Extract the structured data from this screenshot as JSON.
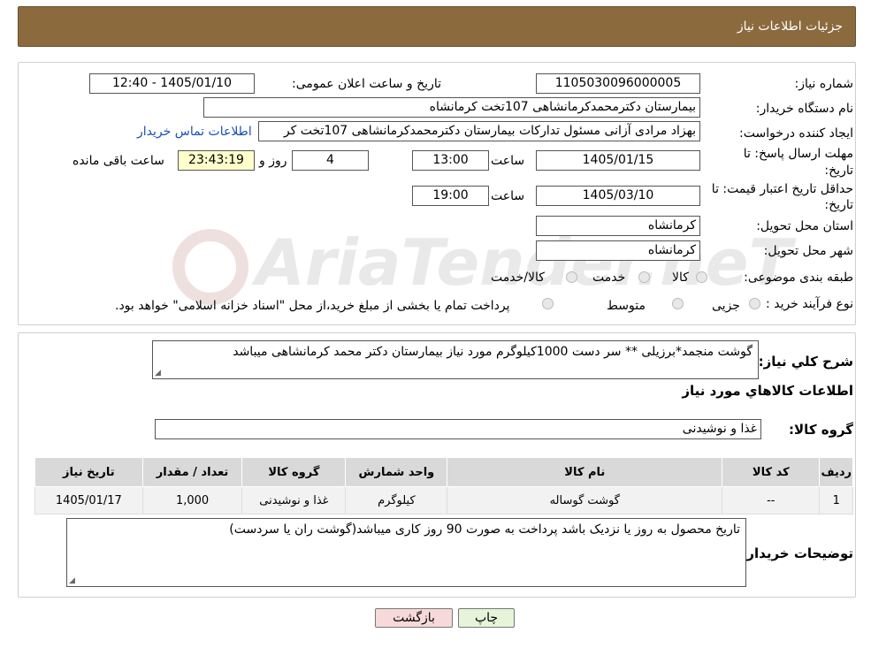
{
  "header": {
    "title": "جزئیات اطلاعات نیاز"
  },
  "watermark": {
    "text": "AriaTender.neT"
  },
  "form": {
    "need_number_label": "شماره نیاز:",
    "need_number": "1105030096000005",
    "announce_label": "تاریخ و ساعت اعلان عمومی:",
    "announce_value": "1405/01/10 - 12:40",
    "buyer_label": "نام دستگاه خریدار:",
    "buyer_value": "بیمارستان دکترمحمدکرمانشاهی 107تخت کرمانشاه",
    "creator_label": "ایجاد کننده درخواست:",
    "creator_value": "بهزاد مرادی آزانی مسئول تدارکات بیمارستان دکترمحمدکرمانشاهی 107تخت کر",
    "contact_link": "اطلاعات تماس خریدار",
    "deadline_label_1": "مهلت ارسال پاسخ: تا",
    "deadline_label_2": "تاریخ:",
    "deadline_date": "1405/01/15",
    "time_label": "ساعت",
    "deadline_time": "13:00",
    "days_value": "4",
    "days_label": "روز و",
    "remaining_time": "23:43:19",
    "remaining_label": "ساعت باقی مانده",
    "validity_label_1": "حداقل تاریخ اعتبار قیمت: تا",
    "validity_label_2": "تاریخ:",
    "validity_date": "1405/03/10",
    "validity_time": "19:00",
    "province_label": "استان محل تحویل:",
    "province_value": "کرمانشاه",
    "city_label": "شهر محل تحویل:",
    "city_value": "کرمانشاه",
    "category_label": "طبقه بندی موضوعی:",
    "category_options": [
      "کالا",
      "خدمت",
      "کالا/خدمت"
    ],
    "process_label": "نوع فرآیند خرید :",
    "process_options": [
      "جزیی",
      "متوسط"
    ],
    "process_note": "پرداخت تمام یا بخشی از مبلغ خرید،از محل \"اسناد خزانه اسلامی\" خواهد بود."
  },
  "summary": {
    "label": "شرح کلي نياز:",
    "text": "گوشت منجمد*برزیلی ** سر دست 1000کیلوگرم مورد نیاز بیمارستان دکتر محمد کرمانشاهی میباشد",
    "goods_info_title": "اطلاعات کالاهاي مورد نياز",
    "group_label": "گروه کالا:",
    "group_value": "غذا و نوشیدنی"
  },
  "table": {
    "headers": [
      "رديف",
      "کد کالا",
      "نام کالا",
      "واحد شمارش",
      "گروه کالا",
      "تعداد / مقدار",
      "تاريخ نياز"
    ],
    "rows": [
      [
        "1",
        "--",
        "گوشت گوساله",
        "کیلوگرم",
        "غذا و نوشیدنی",
        "1,000",
        "1405/01/17"
      ]
    ]
  },
  "notes": {
    "label": "توضیحات خریدار:",
    "text": "تاریخ محصول به روز یا نزدیک باشد پرداخت به صورت 90 روز کاری میباشد(گوشت ران یا   سردست)"
  },
  "buttons": {
    "print": "چاپ",
    "back": "بازگشت"
  },
  "colors": {
    "header_bg": "#8B6A3E",
    "link": "#1a4fb3",
    "highlight": "#FFFFCC",
    "back_button": "#F8D9D9",
    "print_button": "#E6F4DA"
  }
}
